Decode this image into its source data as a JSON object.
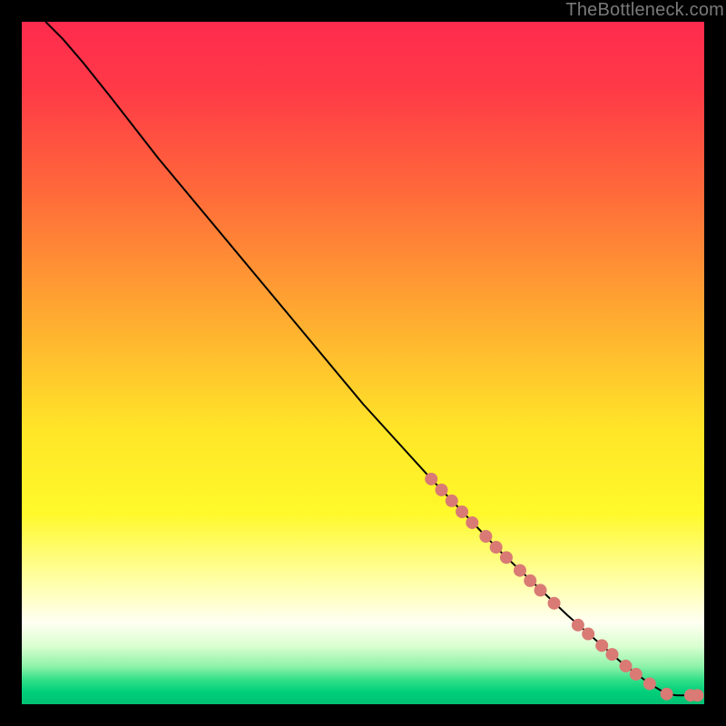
{
  "watermark": "TheBottleneck.com",
  "chart_data": {
    "type": "line",
    "title": "",
    "xlabel": "",
    "ylabel": "",
    "xlim": [
      0,
      100
    ],
    "ylim": [
      0,
      100
    ],
    "gradient_stops": [
      {
        "offset": 0.0,
        "color": "#ff2b4e"
      },
      {
        "offset": 0.1,
        "color": "#ff3a47"
      },
      {
        "offset": 0.25,
        "color": "#ff6a3a"
      },
      {
        "offset": 0.45,
        "color": "#ffb130"
      },
      {
        "offset": 0.6,
        "color": "#ffe628"
      },
      {
        "offset": 0.72,
        "color": "#fff92a"
      },
      {
        "offset": 0.82,
        "color": "#ffffa8"
      },
      {
        "offset": 0.88,
        "color": "#fffff2"
      },
      {
        "offset": 0.915,
        "color": "#d9ffd0"
      },
      {
        "offset": 0.945,
        "color": "#8cf2a8"
      },
      {
        "offset": 0.965,
        "color": "#2fdf87"
      },
      {
        "offset": 0.982,
        "color": "#00cf7a"
      },
      {
        "offset": 1.0,
        "color": "#00c173"
      }
    ],
    "curve": [
      {
        "x": 3.5,
        "y": 100.0
      },
      {
        "x": 6.0,
        "y": 97.5
      },
      {
        "x": 9.0,
        "y": 94.0
      },
      {
        "x": 13.0,
        "y": 89.0
      },
      {
        "x": 20.0,
        "y": 80.0
      },
      {
        "x": 30.0,
        "y": 68.0
      },
      {
        "x": 40.0,
        "y": 56.0
      },
      {
        "x": 50.0,
        "y": 44.0
      },
      {
        "x": 60.0,
        "y": 33.0
      },
      {
        "x": 70.0,
        "y": 22.5
      },
      {
        "x": 80.0,
        "y": 13.0
      },
      {
        "x": 88.0,
        "y": 6.0
      },
      {
        "x": 92.0,
        "y": 3.0
      },
      {
        "x": 94.5,
        "y": 1.5
      },
      {
        "x": 96.0,
        "y": 1.3
      },
      {
        "x": 99.0,
        "y": 1.3
      }
    ],
    "markers": {
      "color": "#d97a74",
      "radius_px": 7,
      "points": [
        {
          "x": 60.0,
          "y": 33.0
        },
        {
          "x": 61.5,
          "y": 31.4
        },
        {
          "x": 63.0,
          "y": 29.8
        },
        {
          "x": 64.5,
          "y": 28.2
        },
        {
          "x": 66.0,
          "y": 26.6
        },
        {
          "x": 68.0,
          "y": 24.6
        },
        {
          "x": 69.5,
          "y": 23.0
        },
        {
          "x": 71.0,
          "y": 21.5
        },
        {
          "x": 73.0,
          "y": 19.6
        },
        {
          "x": 74.5,
          "y": 18.1
        },
        {
          "x": 76.0,
          "y": 16.7
        },
        {
          "x": 78.0,
          "y": 14.8
        },
        {
          "x": 81.5,
          "y": 11.6
        },
        {
          "x": 83.0,
          "y": 10.3
        },
        {
          "x": 85.0,
          "y": 8.6
        },
        {
          "x": 86.5,
          "y": 7.3
        },
        {
          "x": 88.5,
          "y": 5.6
        },
        {
          "x": 90.0,
          "y": 4.4
        },
        {
          "x": 92.0,
          "y": 3.0
        },
        {
          "x": 94.5,
          "y": 1.5
        },
        {
          "x": 98.0,
          "y": 1.3
        },
        {
          "x": 99.0,
          "y": 1.3
        }
      ]
    }
  }
}
